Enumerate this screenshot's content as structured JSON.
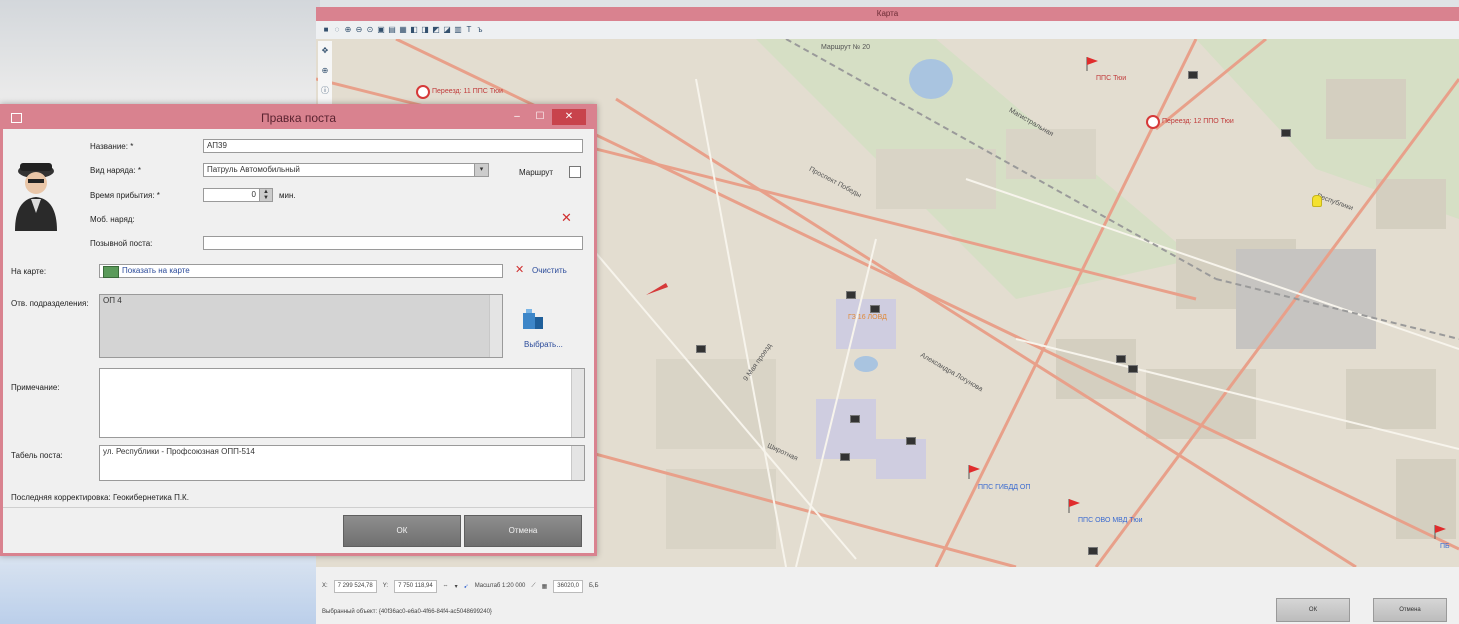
{
  "map_window": {
    "title": "Карта",
    "labels": {
      "route": "Маршрут № 20",
      "crossing1": "Переезд: 11 ППС Тюи",
      "crossing2": "Переезд: 12 ППО Тюи",
      "post_top": "ППС Тюи",
      "post_center": "ГЗ 16 ЛОВД",
      "post_bottom1": "ППС ГИБДД ОП",
      "post_bottom2": "ППС ОВО МВД Тюи",
      "post_right": "ПБ",
      "street1": "Магистральная",
      "street2": "Широтная",
      "street3": "Республики",
      "street4": "Александра Логунова",
      "street5": "Проспект Победы",
      "street6": "9 Мая проезд"
    },
    "status": {
      "x_label": "X:",
      "x_value": "7 299 524,78",
      "y_label": "Y:",
      "y_value": "7 750 118,94",
      "scale_label": "Масштаб 1:20 000",
      "zoom_value": "36020,0",
      "unit": "Б,Б"
    },
    "selected_object": "Выбранный объект: {40f36ac0-e6a0-4f66-84f4-ac5048699240}",
    "ok_label": "ОК",
    "cancel_label": "Отмена"
  },
  "dialog": {
    "title": "Правка поста",
    "name_label": "Название: *",
    "name_value": "АП39",
    "type_label": "Вид наряда: *",
    "type_value": "Патруль Автомобильный",
    "route_label": "Маршрут",
    "arrival_label": "Время прибытия: *",
    "arrival_value": "0",
    "arrival_unit": "мин.",
    "mobile_label": "Моб. наряд:",
    "callsign_label": "Позывной поста:",
    "callsign_value": "",
    "onmap_label": "На карте:",
    "show_on_map": "Показать на карте",
    "clear_label": "Очистить",
    "dept_label": "Отв. подразделения:",
    "dept_value": "ОП 4",
    "select_label": "Выбрать...",
    "note_label": "Примечание:",
    "note_value": "",
    "table_label": "Табель поста:",
    "table_value": "ул. Республики - Профсоюзная ОПП-514",
    "last_edit": "Последняя корректировка: Геокибернетика П.К.",
    "ok_label": "ОК",
    "cancel_label": "Отмена"
  },
  "colors": {
    "titlebar": "#d9828f",
    "close_button": "#c8434c",
    "road": "#e8a08a",
    "map_bg": "#e3ddd0"
  }
}
